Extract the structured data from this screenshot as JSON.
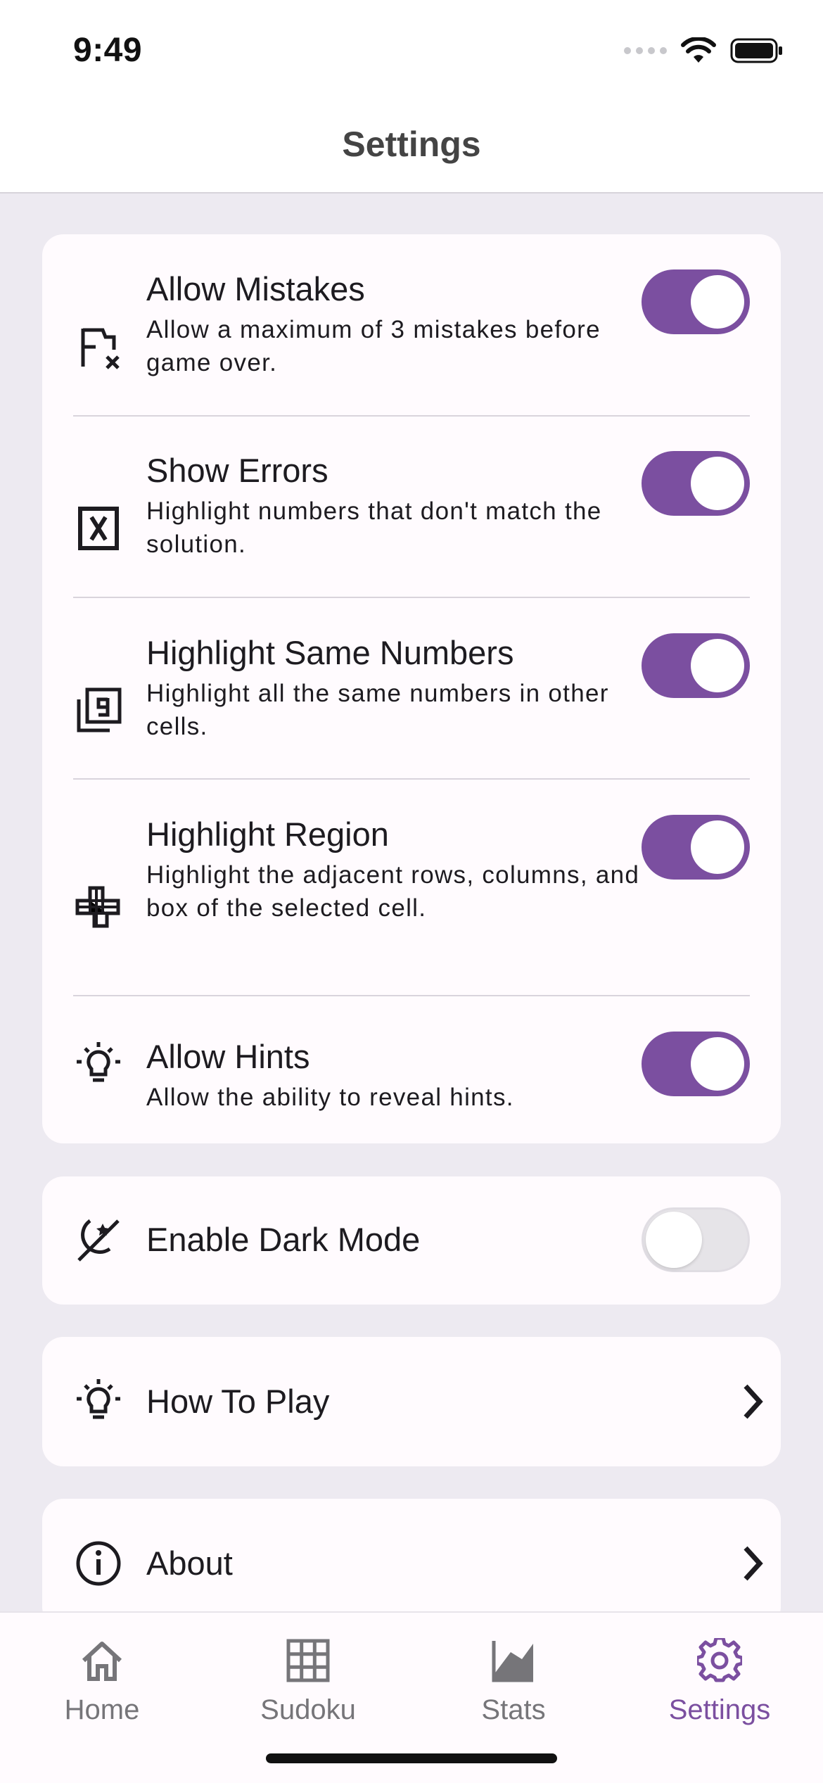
{
  "status_bar": {
    "time": "9:49"
  },
  "header": {
    "title": "Settings"
  },
  "settings": [
    {
      "label": "Allow Mistakes",
      "desc": "Allow a maximum of 3 mistakes before game over.",
      "icon": "flag-x-icon",
      "enabled": true
    },
    {
      "label": "Show Errors",
      "desc": "Highlight numbers that don't match the solution.",
      "icon": "error-box-icon",
      "enabled": true
    },
    {
      "label": "Highlight Same Numbers",
      "desc": "Highlight all the same numbers in other cells.",
      "icon": "filter-9-icon",
      "enabled": true
    },
    {
      "label": "Highlight Region",
      "desc": "Highlight the adjacent rows, columns, and box of the selected cell.",
      "icon": "grid-cross-icon",
      "enabled": true
    },
    {
      "label": "Allow Hints",
      "desc": "Allow the ability to reveal hints.",
      "icon": "lightbulb-icon",
      "enabled": true
    }
  ],
  "dark_mode": {
    "label": "Enable Dark Mode",
    "icon": "dark-mode-icon",
    "enabled": false
  },
  "how_to_play": {
    "label": "How To Play",
    "icon": "lightbulb-icon"
  },
  "about": {
    "label": "About",
    "icon": "info-icon"
  },
  "bottom_nav": [
    {
      "label": "Home",
      "icon": "home-icon",
      "active": false
    },
    {
      "label": "Sudoku",
      "icon": "grid-icon",
      "active": false
    },
    {
      "label": "Stats",
      "icon": "chart-icon",
      "active": false
    },
    {
      "label": "Settings",
      "icon": "gear-icon",
      "active": true
    }
  ],
  "colors": {
    "accent": "#7B4FA0",
    "background": "#EDEAF1",
    "card": "#FFFBFE"
  }
}
